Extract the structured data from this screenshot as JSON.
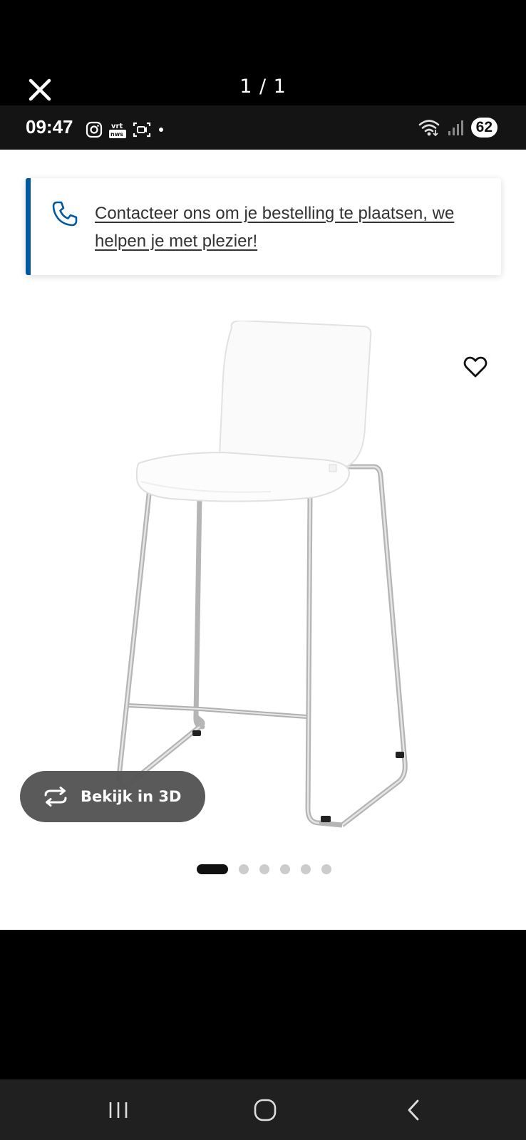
{
  "viewer": {
    "counter": "1 / 1"
  },
  "status_bar": {
    "time": "09:47",
    "battery": "62",
    "left_icons": [
      "instagram-icon",
      "vrt-nws-icon",
      "screen-recorder-icon",
      "notification-dot"
    ],
    "right_icons": [
      "wifi-icon",
      "signal-icon",
      "battery-icon"
    ]
  },
  "banner": {
    "text": "Contacteer ons om je bestelling te plaatsen, we helpen je met plezier!",
    "icon": "phone-icon",
    "accent_color": "#0058a3"
  },
  "product": {
    "image_icon": "bar-stool-image",
    "favorite_icon": "heart-icon",
    "view_3d_label": "Bekijk in 3D",
    "view_3d_icon": "rotate-3d-icon",
    "carousel": {
      "total": 6,
      "active_index": 0
    }
  },
  "nav_bar": {
    "buttons": [
      "recent-apps-icon",
      "home-icon",
      "back-icon"
    ]
  }
}
